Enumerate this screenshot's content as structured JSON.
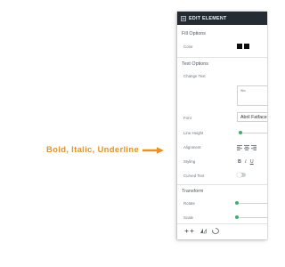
{
  "callout": {
    "text": "Bold, Italic, Underline",
    "color": "#e8912b"
  },
  "panel": {
    "title": "EDIT ELEMENT",
    "header_color": "#252b33",
    "fill": {
      "section_title": "Fill Options",
      "color_label": "Color",
      "swatches": [
        "#0e0e0e",
        "#0e0e0e"
      ]
    },
    "text": {
      "section_title": "Text Options",
      "change_text_label": "Change Text",
      "change_text_value": "Wix",
      "font_label": "Font",
      "font_value": "Abril Fatface",
      "line_height_label": "Line Height",
      "line_height_value": 0.05,
      "alignment_label": "Alignment",
      "styling_label": "Styling",
      "bold": "B",
      "italic": "I",
      "underline": "U",
      "curved_text_label": "Curved Text",
      "curved_text_on": false
    },
    "transform": {
      "section_title": "Transform",
      "rotate_label": "Rotate",
      "rotate_value": 0.0,
      "scale_label": "Scale",
      "scale_value": 0.0
    },
    "accent_color": "#3fb06b",
    "toolbar_icons": [
      "flip-horizontal-icon",
      "flip-vertical-icon",
      "bring-forward-icon",
      "send-backward-icon",
      "duplicate-icon"
    ]
  }
}
